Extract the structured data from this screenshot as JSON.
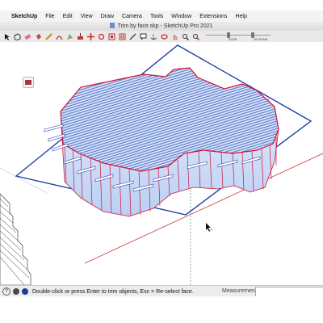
{
  "menubar": {
    "apple": "",
    "items": [
      "SketchUp",
      "File",
      "Edit",
      "View",
      "Draw",
      "Camera",
      "Tools",
      "Window",
      "Extensions",
      "Help"
    ]
  },
  "window": {
    "title": "Trim by face.skp - SketchUp Pro 2021"
  },
  "toolbar": {
    "tools": [
      "select-tool",
      "make-component-tool",
      "eraser-tool",
      "paint-bucket-tool",
      "pencil-line-tool",
      "arc-tool",
      "shape-tool",
      "push-pull-tool",
      "move-tool",
      "rotate-tool",
      "scale-tool",
      "offset-tool",
      "tape-measure-tool",
      "text-tool",
      "axes-tool",
      "orbit-tool",
      "pan-tool",
      "zoom-tool",
      "zoom-extents-tool"
    ],
    "timeline": {
      "date": "02/28",
      "time": "10:00 AM"
    }
  },
  "status": {
    "message": "Double-click or press Enter to trim objects, Esc = Re-select face.",
    "measurements_label": "Measurements",
    "measurements_value": ""
  },
  "colors": {
    "edge_red": "#d2123a",
    "plane_blue": "#1d3ea8",
    "fill_blue": "#bcd3f5"
  }
}
